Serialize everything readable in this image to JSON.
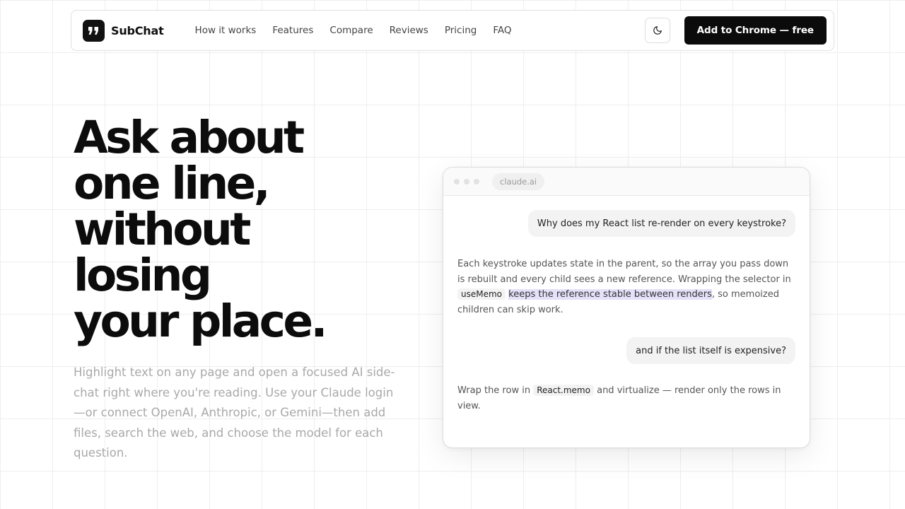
{
  "nav": {
    "brand": "SubChat",
    "links": [
      "How it works",
      "Features",
      "Compare",
      "Reviews",
      "Pricing",
      "FAQ"
    ],
    "theme_icon": "moon-icon",
    "cta": "Add to Chrome — free"
  },
  "hero": {
    "title_lines": [
      "Ask about",
      "one line,",
      "without",
      "losing",
      "your place."
    ],
    "subtitle": "Highlight text on any page and open a focused AI side-chat right where you're reading. Use your Claude login—or connect OpenAI, Anthropic, or Gemini—then add files, search the web, and choose the model for each question."
  },
  "mock": {
    "url": "claude.ai",
    "user_msg_1": "Why does my React list re-render on every keystroke?",
    "ai_msg_1": {
      "part1": "Each keystroke updates state in the parent, so the array you pass down is rebuilt and every child sees a new reference. Wrapping the selector in ",
      "code": "useMemo",
      "highlight": "keeps the reference stable between renders",
      "part2": ", so memoized children can skip work."
    },
    "user_msg_2": "and if the list itself is expensive?",
    "ai_msg_2": {
      "part1": "Wrap the row in ",
      "code": "React.memo",
      "part2": " and virtualize — render only the rows in view."
    }
  },
  "colors": {
    "primary": "#0b0b0b",
    "highlight": "#e4e1f9",
    "subtitle": "#a9a9a9"
  }
}
